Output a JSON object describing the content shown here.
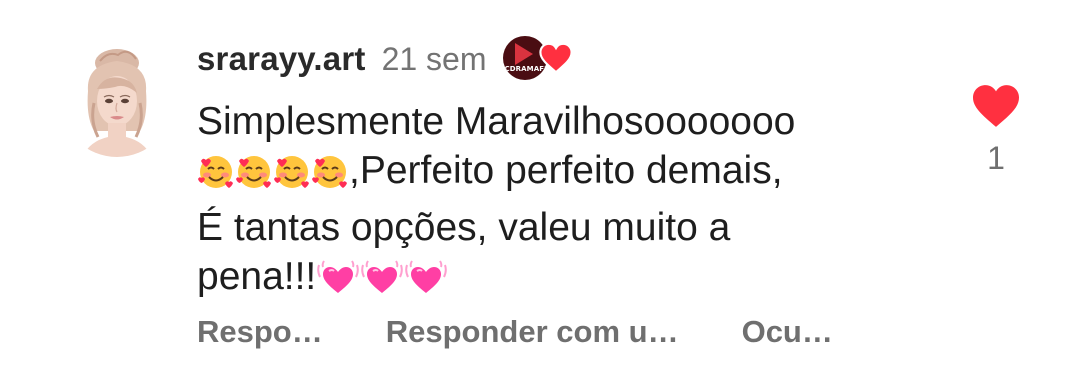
{
  "comment": {
    "username": "srarayy.art",
    "time": "21 sem",
    "creator_badge_label": "CDRAMAFL",
    "body_lines": [
      "Simplesmente Maravilhosooooooo",
      ",Perfeito perfeito demais,",
      "É tantas opções, valeu muito a",
      "pena!!!"
    ],
    "emojis": {
      "line2": [
        "smiling-face-with-hearts",
        "smiling-face-with-hearts",
        "smiling-face-with-hearts",
        "smiling-face-with-hearts"
      ],
      "line4": [
        "beating-heart",
        "beating-heart",
        "beating-heart"
      ]
    },
    "actions": [
      "Respo…",
      "Responder com u…",
      "Ocu…"
    ],
    "like_count": "1"
  },
  "colors": {
    "like_red": "#ff3040",
    "muted_text": "#737373",
    "pink_heart": "#ff3fa4",
    "emoji_yellow": "#ffc53d"
  }
}
